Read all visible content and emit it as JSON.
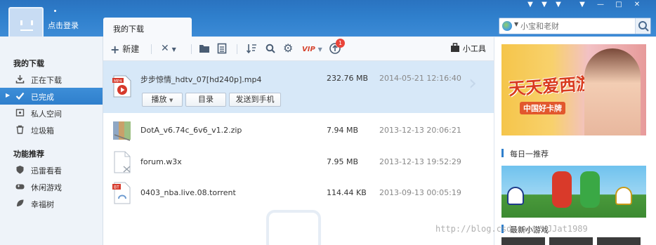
{
  "header": {
    "login_label": "点击登录",
    "active_tab": "我的下载",
    "skin_icons": [
      "shirt-icon",
      "shirt-icon",
      "shirt-icon"
    ],
    "window_buttons": [
      "menu-icon",
      "minimize-icon",
      "maximize-icon",
      "close-icon"
    ],
    "search": {
      "placeholder": "小宝和老财",
      "icon": "search-icon"
    }
  },
  "sidebar": {
    "section1_title": "我的下载",
    "items1": [
      {
        "label": "正在下载",
        "icon": "download-icon"
      },
      {
        "label": "已完成",
        "icon": "check-icon"
      },
      {
        "label": "私人空间",
        "icon": "private-space-icon"
      },
      {
        "label": "垃圾箱",
        "icon": "trash-icon"
      }
    ],
    "section2_title": "功能推荐",
    "items2": [
      {
        "label": "迅雷看看",
        "icon": "shield-icon"
      },
      {
        "label": "休闲游戏",
        "icon": "gamepad-icon"
      },
      {
        "label": "幸福树",
        "icon": "leaf-icon"
      }
    ]
  },
  "toolbar": {
    "new_label": "新建",
    "tools_label": "小工具",
    "notification_count": "1",
    "icons": [
      "plus-icon",
      "delete-icon",
      "folder-icon",
      "document-icon",
      "sort-icon",
      "search-icon",
      "settings-icon",
      "vip-icon",
      "upload-icon",
      "toolbox-icon"
    ]
  },
  "files": [
    {
      "name": "步步惊情_hdtv_07[hd240p].mp4",
      "size": "232.76 MB",
      "date": "2014-05-21 12:16:40",
      "icon": "video-file-icon",
      "type_tag": "MP4"
    },
    {
      "name": "DotA_v6.74c_6v6_v1.2.zip",
      "size": "7.94 MB",
      "date": "2013-12-13 20:06:21",
      "icon": "archive-file-icon"
    },
    {
      "name": "forum.w3x",
      "size": "7.95 MB",
      "date": "2013-12-13 19:52:29",
      "icon": "generic-file-icon"
    },
    {
      "name": "0403_nba.live.08.torrent",
      "size": "114.44 KB",
      "date": "2013-09-13 00:05:19",
      "icon": "torrent-file-icon",
      "type_tag": "BT"
    }
  ],
  "row_actions": {
    "play": "播放",
    "dir": "目录",
    "send": "发送到手机"
  },
  "right_panel": {
    "banner_title": "天天爱西游",
    "banner_sub": "中国好卡牌",
    "daily_title": "每日一推荐",
    "new_games_title": "最新小游戏"
  },
  "watermark": "http://blog.csdn.net/YJJat1989"
}
